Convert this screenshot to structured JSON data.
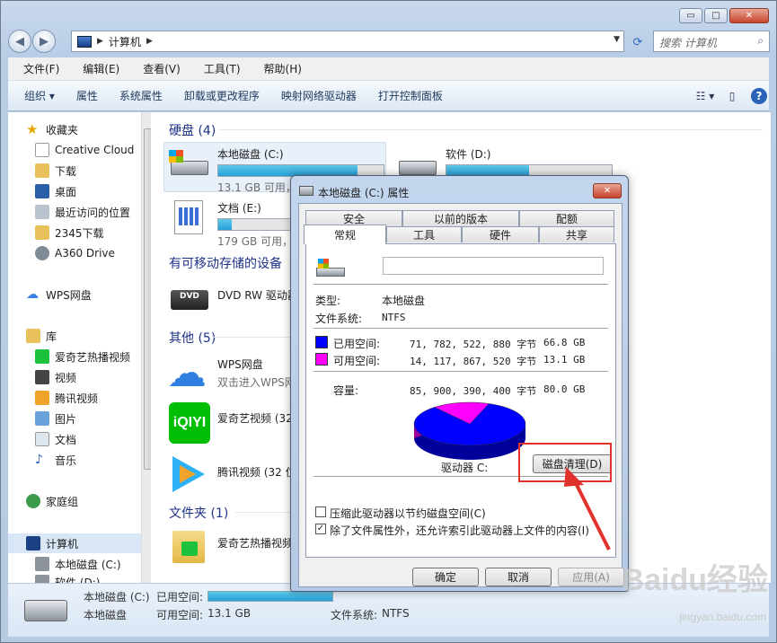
{
  "window": {
    "minimize": "▭",
    "maximize": "□",
    "close": "✕"
  },
  "address": {
    "crumb": "计算机",
    "search_placeholder": "搜索 计算机"
  },
  "menu": [
    "文件(F)",
    "编辑(E)",
    "查看(V)",
    "工具(T)",
    "帮助(H)"
  ],
  "toolbar": [
    "组织 ▾",
    "属性",
    "系统属性",
    "卸载或更改程序",
    "映射网络驱动器",
    "打开控制面板"
  ],
  "nav": {
    "favorites": "收藏夹",
    "creative_cloud": "Creative Cloud",
    "downloads": "下载",
    "desktop": "桌面",
    "recent": "最近访问的位置",
    "d2345": "2345下载",
    "a360": "A360 Drive",
    "wps": "WPS网盘",
    "library": "库",
    "iqiyi": "爱奇艺热播视频",
    "video": "视频",
    "tencent": "腾讯视频",
    "pictures": "图片",
    "documents": "文档",
    "music": "音乐",
    "homegroup": "家庭组",
    "computer": "计算机",
    "local_c": "本地磁盘 (C:)",
    "software_d": "软件 (D:)"
  },
  "groups": {
    "hdd": "硬盘 (4)",
    "removable": "有可移动存储的设备",
    "other": "其他 (5)",
    "folder": "文件夹 (1)"
  },
  "drives": [
    {
      "name": "本地磁盘 (C:)",
      "free": "13.1 GB 可用，",
      "used_fraction": 0.84
    },
    {
      "name": "软件 (D:)",
      "free": "",
      "used_fraction": 0.5
    },
    {
      "name": "文档 (E:)",
      "free": "179 GB 可用，",
      "used_fraction": 0.08
    }
  ],
  "other_items": {
    "dvd": "DVD RW 驱动器",
    "wps": "WPS网盘",
    "wps_sub": "双击进入WPS网",
    "iqiyi": "爱奇艺视频 (32",
    "tencent": "腾讯视频 (32 位",
    "folder": "爱奇艺热播视频"
  },
  "status": {
    "name": "本地磁盘 (C:)",
    "type": "本地磁盘",
    "used_label": "已用空间:",
    "free_label": "可用空间:",
    "free_value": "13.1 GB",
    "fs_label": "文件系统:",
    "fs_value": "NTFS"
  },
  "dialog": {
    "title": "本地磁盘 (C:) 属性",
    "tabs_top": [
      "安全",
      "以前的版本",
      "配额"
    ],
    "tabs_bottom": [
      "常规",
      "工具",
      "硬件",
      "共享"
    ],
    "type_label": "类型:",
    "type_value": "本地磁盘",
    "fs_label": "文件系统:",
    "fs_value": "NTFS",
    "used_label": "已用空间:",
    "used_bytes": "71, 782, 522, 880 字节",
    "used_gb": "66.8 GB",
    "free_label": "可用空间:",
    "free_bytes": "14, 117, 867, 520 字节",
    "free_gb": "13.1 GB",
    "cap_label": "容量:",
    "cap_bytes": "85, 900, 390, 400 字节",
    "cap_gb": "80.0 GB",
    "drive_label": "驱动器 C:",
    "cleanup": "磁盘清理(D)",
    "compress": "压缩此驱动器以节约磁盘空间(C)",
    "index": "除了文件属性外，还允许索引此驱动器上文件的内容(I)",
    "ok": "确定",
    "cancel": "取消",
    "apply": "应用(A)",
    "used_fraction": 0.8357,
    "colors": {
      "used": "#0000ff",
      "free": "#ff00ff"
    }
  },
  "watermark": {
    "main": "Baidu经验",
    "sub": "jingyan.baidu.com"
  }
}
